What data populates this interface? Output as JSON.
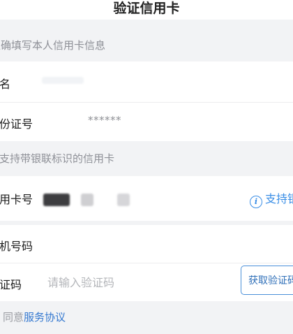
{
  "header": {
    "title": "验证信用卡"
  },
  "section_identity": {
    "text": "正确填写本人信用卡信息"
  },
  "fields": {
    "name": {
      "label": "名"
    },
    "id_number": {
      "label": "份证号",
      "value": "******"
    }
  },
  "section_card": {
    "text": "支持带银联标识的信用卡"
  },
  "card_number": {
    "label": "用卡号"
  },
  "support": {
    "label": "支持银",
    "icon": "info-icon"
  },
  "phone": {
    "label": "机号码"
  },
  "verify_code": {
    "label": "证码",
    "placeholder": "请输入验证码",
    "button_label": "获取验证码"
  },
  "agreement": {
    "prefix": "同意",
    "link_text": "服务协议"
  },
  "colors": {
    "accent": "#3a8ee6",
    "background": "#f2f3f5"
  }
}
